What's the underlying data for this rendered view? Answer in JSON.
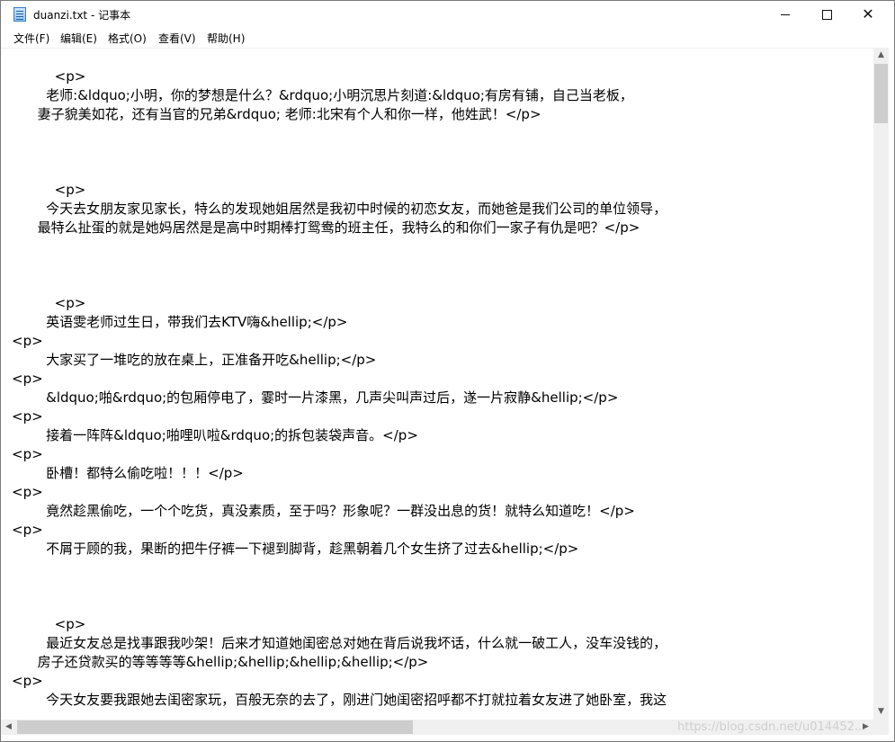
{
  "window": {
    "title": "duanzi.txt - 记事本",
    "minimize_symbol": "",
    "close_symbol": "✕"
  },
  "menu": {
    "items": [
      {
        "label": "文件(F)"
      },
      {
        "label": "编辑(E)"
      },
      {
        "label": "格式(O)"
      },
      {
        "label": "查看(V)"
      },
      {
        "label": "帮助(H)"
      }
    ]
  },
  "editor": {
    "lines": [
      {
        "text": "          <p>"
      },
      {
        "text": "        老师:&ldquo;小明，你的梦想是什么？&rdquo;小明沉思片刻道:&ldquo;有房有铺，自己当老板，"
      },
      {
        "text": "      妻子貌美如花，还有当官的兄弟&rdquo; 老师:北宋有个人和你一样，他姓武！</p>"
      },
      {
        "text": "          <p>"
      },
      {
        "text": "        今天去女朋友家见家长，特么的发现她姐居然是我初中时候的初恋女友，而她爸是我们公司的单位领导，"
      },
      {
        "text": "      最特么扯蛋的就是她妈居然是是高中时期棒打鸳鸯的班主任，我特么的和你们一家子有仇是吧？</p>"
      },
      {
        "text": "          <p>"
      },
      {
        "text": "        英语雯老师过生日，带我们去KTV嗨&hellip;</p>"
      },
      {
        "text": "<p>"
      },
      {
        "text": "        大家买了一堆吃的放在桌上，正准备开吃&hellip;</p>"
      },
      {
        "text": "<p>"
      },
      {
        "text": "        &ldquo;啪&rdquo;的包厢停电了，霎时一片漆黑，几声尖叫声过后，遂一片寂静&hellip;</p>"
      },
      {
        "text": "<p>"
      },
      {
        "text": "        接着一阵阵&ldquo;啪哩叭啦&rdquo;的拆包装袋声音。</p>"
      },
      {
        "text": "<p>"
      },
      {
        "text": "        卧槽！都特么偷吃啦！！！</p>"
      },
      {
        "text": "<p>"
      },
      {
        "text": "        竟然趁黑偷吃，一个个吃货，真没素质，至于吗？形象呢？一群没出息的货！就特么知道吃！</p>"
      },
      {
        "text": "<p>"
      },
      {
        "text": "        不屑于顾的我，果断的把牛仔裤一下褪到脚背，趁黑朝着几个女生挤了过去&hellip;</p>"
      },
      {
        "text": "          <p>"
      },
      {
        "text": "        最近女友总是找事跟我吵架！后来才知道她闺密总对她在背后说我坏话，什么就一破工人，没车没钱的，"
      },
      {
        "text": "      房子还贷款买的等等等等&hellip;&hellip;&hellip;&hellip;</p>"
      },
      {
        "text": "<p>"
      },
      {
        "text": "        今天女友要我跟她去闺密家玩，百般无奈的去了，刚进门她闺密招呼都不打就拉着女友进了她卧室，我这"
      }
    ]
  },
  "watermark": "https://blog.csdn.net/u014452..."
}
